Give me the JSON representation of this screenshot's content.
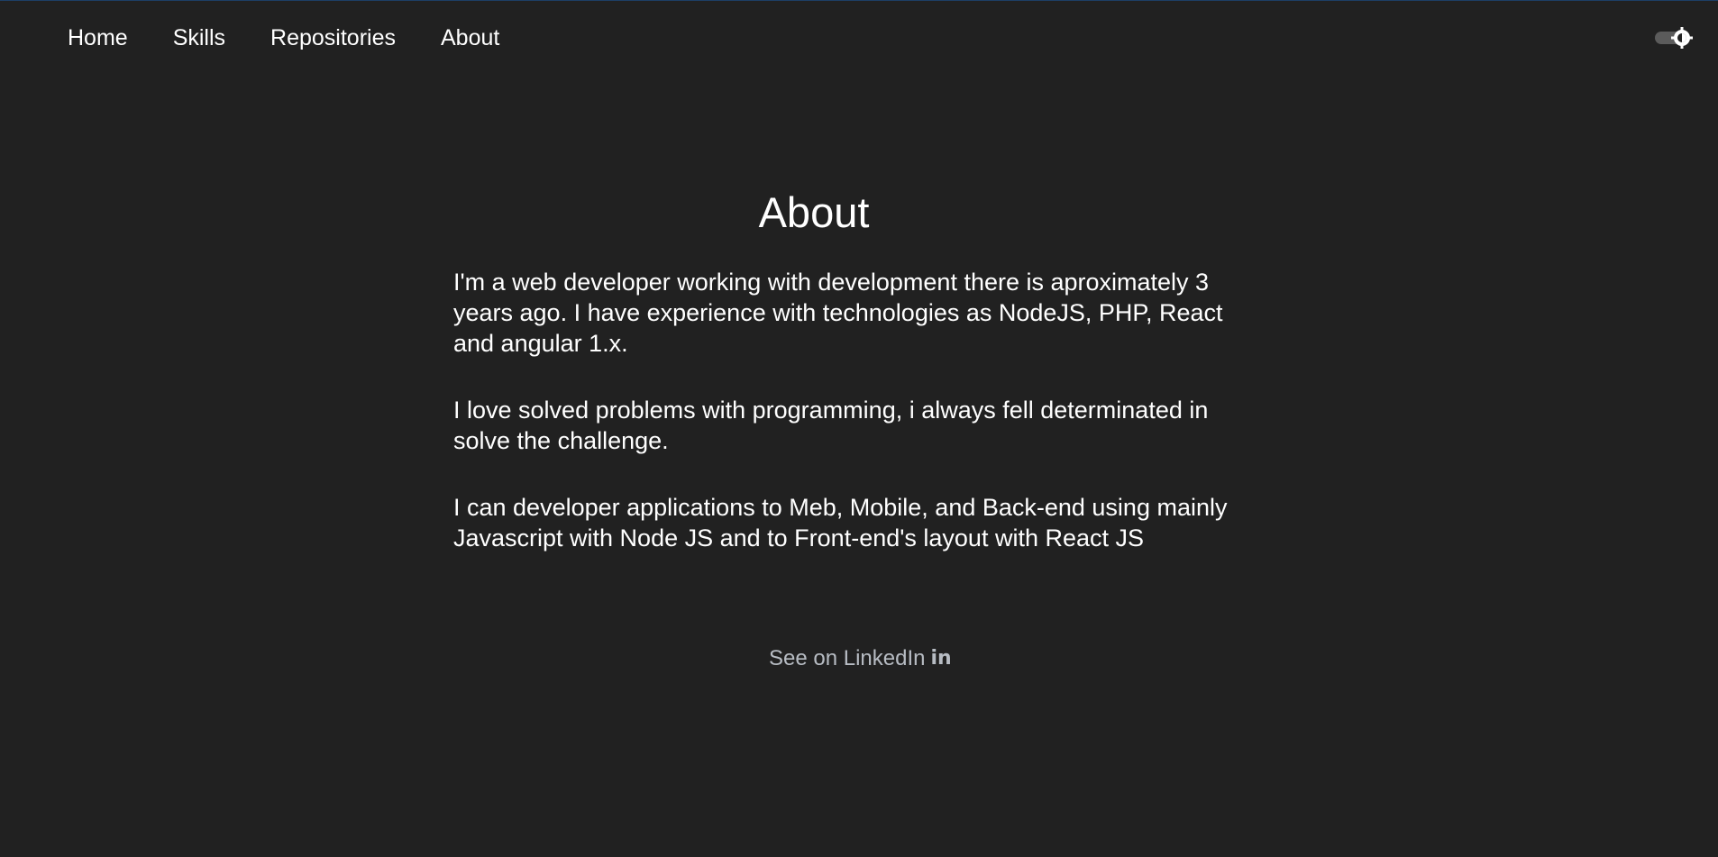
{
  "nav": {
    "items": [
      {
        "label": "Home"
      },
      {
        "label": "Skills"
      },
      {
        "label": "Repositories"
      },
      {
        "label": "About"
      }
    ]
  },
  "theme_toggle": {
    "icon": "sun-icon"
  },
  "about": {
    "title": "About",
    "paragraphs": [
      "I'm a web developer working with development there is aproximately 3 years ago. I have experience with technologies as NodeJS, PHP, React and angular 1.x.",
      "I love solved problems with programming, i always fell determinated in solve the challenge.",
      "I can developer applications to Meb, Mobile, and Back-end using mainly Javascript with Node JS and to Front-end's layout with React JS"
    ],
    "linkedin_label": "See on LinkedIn",
    "linkedin_icon": "linkedin-icon"
  },
  "colors": {
    "background": "#212121",
    "text": "#ffffff",
    "link": "#b7bcc3"
  }
}
